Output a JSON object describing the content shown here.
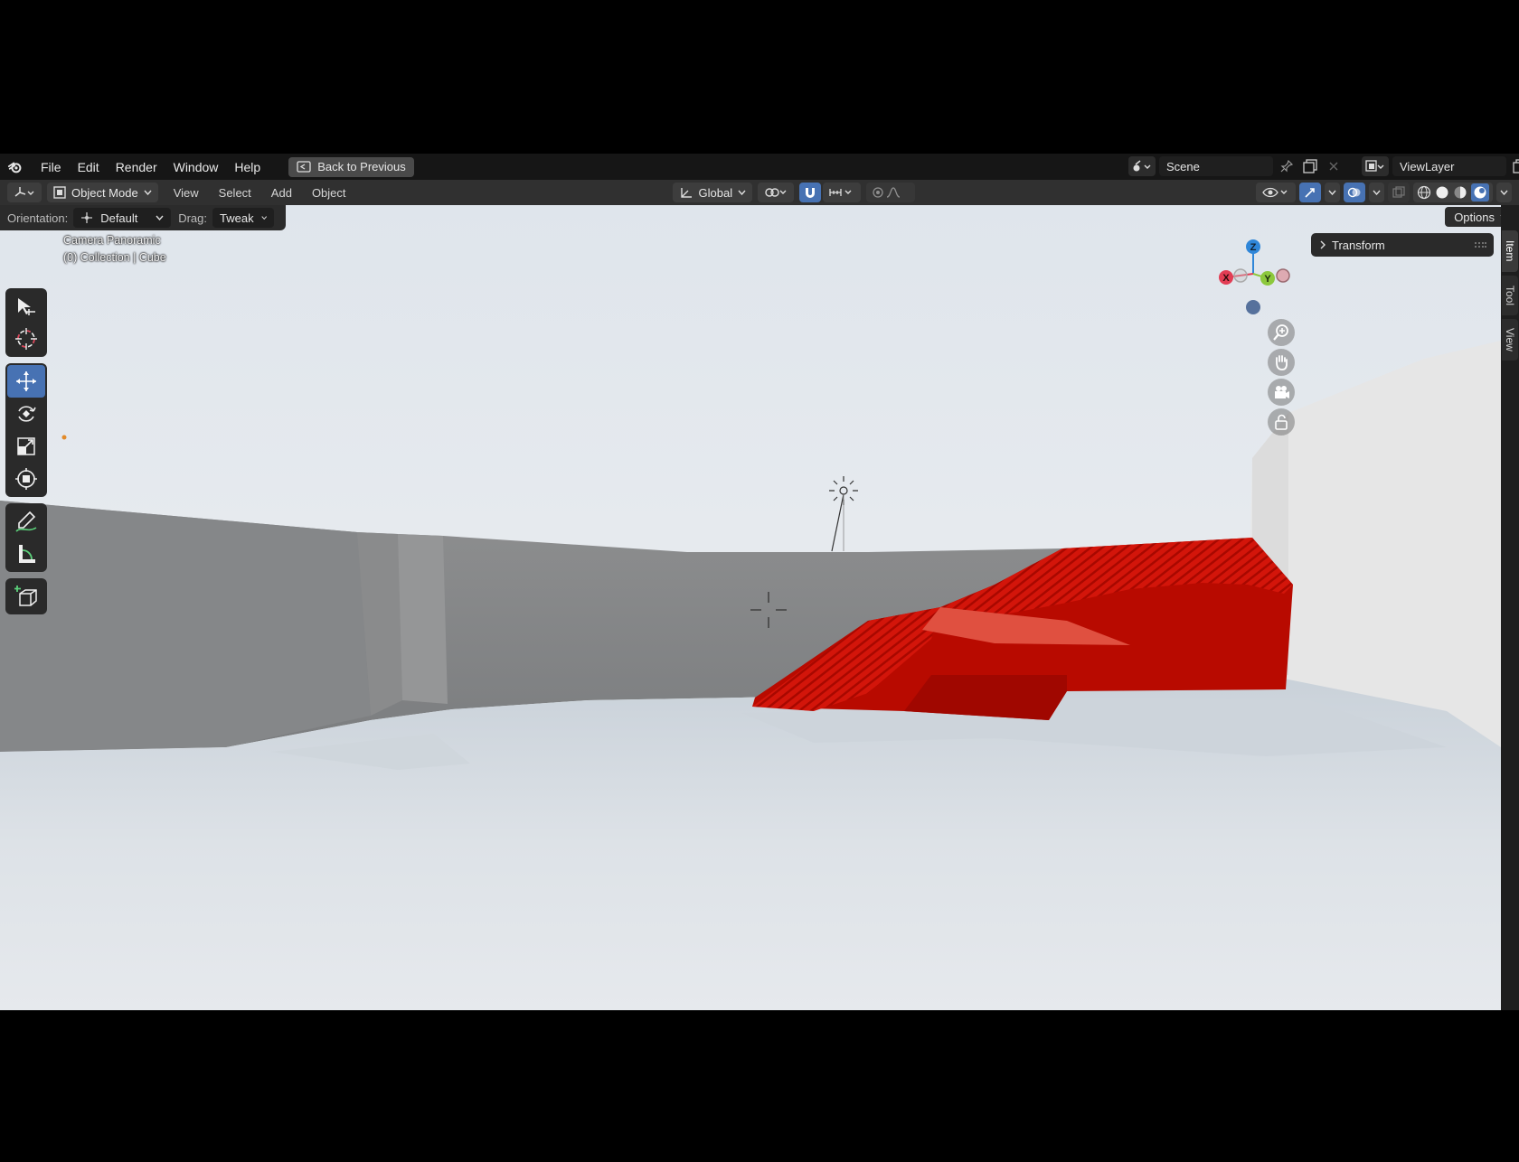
{
  "menubar": {
    "items": [
      "File",
      "Edit",
      "Render",
      "Window",
      "Help"
    ],
    "back_button": "Back to Previous",
    "scene": "Scene",
    "view_layer": "ViewLayer"
  },
  "header": {
    "mode": "Object Mode",
    "menus": [
      "View",
      "Select",
      "Add",
      "Object"
    ],
    "transform_orientation": "Global"
  },
  "tool_settings": {
    "orientation_label": "Orientation:",
    "orientation_value": "Default",
    "drag_label": "Drag:",
    "drag_value": "Tweak",
    "options": "Options"
  },
  "viewport": {
    "camera_label": "Camera Panoramic",
    "collection_label": "(0) Collection | Cube",
    "gizmo_axes": {
      "x": "X",
      "y": "Y",
      "z": "Z"
    }
  },
  "sidebar": {
    "panel_title": "Transform",
    "tabs": [
      "Item",
      "Tool",
      "View"
    ]
  },
  "toolbar": {
    "tools": [
      "select-box-icon",
      "cursor-icon",
      "move-icon",
      "rotate-icon",
      "scale-icon",
      "transform-icon",
      "annotate-icon",
      "measure-icon",
      "add-cube-icon"
    ],
    "active_tool": "move-icon"
  },
  "colors": {
    "accent": "#4772b3",
    "stairs": "#c40a00",
    "axis_x": "#e23d54",
    "axis_y": "#8cc83c",
    "axis_z": "#2f86d8"
  }
}
